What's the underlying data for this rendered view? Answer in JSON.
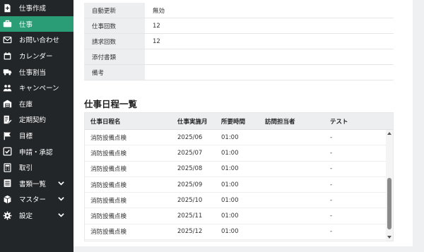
{
  "sidebar": {
    "items": [
      {
        "label": "仕事作成",
        "icon": "add-document-icon"
      },
      {
        "label": "仕事",
        "icon": "briefcase-icon",
        "active": true
      },
      {
        "label": "お問い合わせ",
        "icon": "mail-icon"
      },
      {
        "label": "カレンダー",
        "icon": "calendar-icon"
      },
      {
        "label": "仕事割当",
        "icon": "truck-icon"
      },
      {
        "label": "キャンペーン",
        "icon": "people-icon"
      },
      {
        "label": "在庫",
        "icon": "warehouse-icon"
      },
      {
        "label": "定期契約",
        "icon": "contract-icon"
      },
      {
        "label": "目標",
        "icon": "flag-icon"
      },
      {
        "label": "申請・承認",
        "icon": "checkbox-icon"
      },
      {
        "label": "取引",
        "icon": "calculator-icon"
      },
      {
        "label": "書類一覧",
        "icon": "document-stack-icon",
        "expandable": true
      },
      {
        "label": "マスター",
        "icon": "boxes-icon",
        "expandable": true
      },
      {
        "label": "設定",
        "icon": "gear-icon",
        "expandable": true
      }
    ]
  },
  "detail": {
    "rows": [
      {
        "label": "自動更新",
        "value": "無効"
      },
      {
        "label": "仕事回数",
        "value": "12"
      },
      {
        "label": "請求回数",
        "value": "12"
      },
      {
        "label": "添付書類",
        "value": ""
      },
      {
        "label": "備考",
        "value": ""
      }
    ]
  },
  "schedule": {
    "title": "仕事日程一覧",
    "headers": [
      "仕事日程名",
      "仕事実施月",
      "所要時間",
      "訪問担当者",
      "テスト"
    ],
    "rows": [
      [
        "消防設備点検",
        "2025/06",
        "01:00",
        "",
        "-"
      ],
      [
        "消防設備点検",
        "2025/07",
        "01:00",
        "",
        "-"
      ],
      [
        "消防設備点検",
        "2025/08",
        "01:00",
        "",
        "-"
      ],
      [
        "消防設備点検",
        "2025/09",
        "01:00",
        "",
        "-"
      ],
      [
        "消防設備点検",
        "2025/10",
        "01:00",
        "",
        "-"
      ],
      [
        "消防設備点検",
        "2025/11",
        "01:00",
        "",
        "-"
      ],
      [
        "消防設備点検",
        "2025/12",
        "01:00",
        "",
        "-"
      ]
    ]
  },
  "colors": {
    "sidebar_bg": "#232629",
    "active_bg": "#2a9d76",
    "label_bg": "#eceef0"
  }
}
